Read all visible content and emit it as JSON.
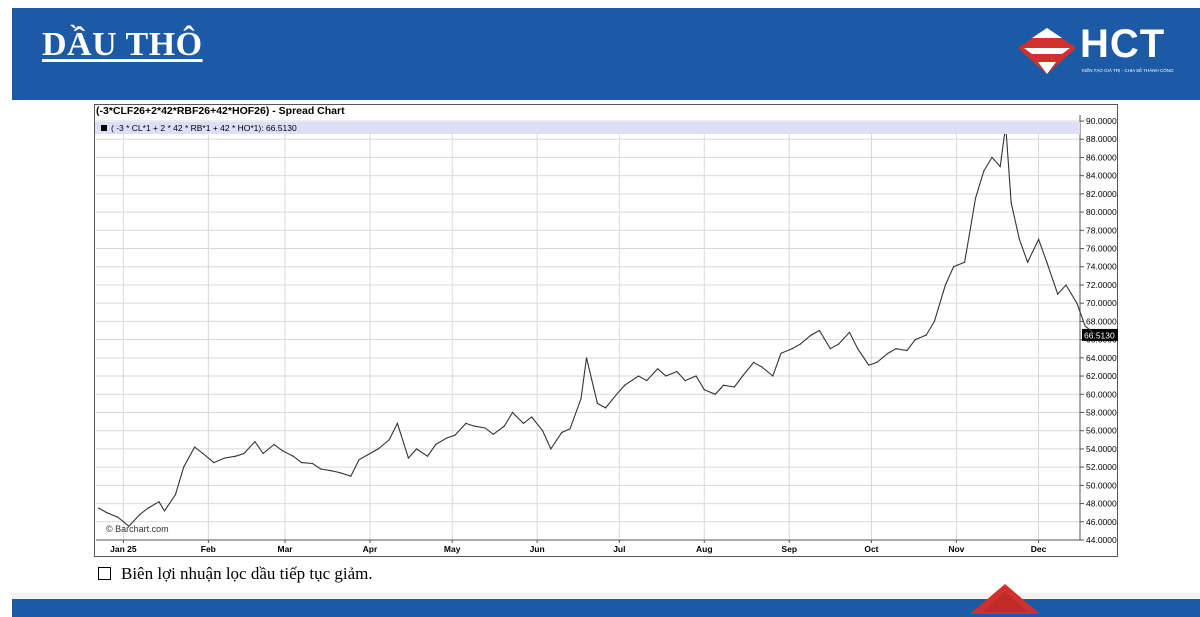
{
  "slide": {
    "title": "DẦU THÔ",
    "logo_text": "HCT",
    "logo_tagline": "KIẾN TẠO GIÁ TRỊ - CHIA SẺ THÀNH CÔNG",
    "note": "Biên lợi nhuận lọc dầu tiếp tục giảm.",
    "colors": {
      "header": "#1c5aa6",
      "logo_red": "#d0312d",
      "line": "#333333"
    }
  },
  "chart_data": {
    "type": "line",
    "title": "(-3*CLF26+2*42*RBF26+42*HOF26) - Spread Chart",
    "legend": "( -3 * CL*1 + 2 * 42 * RB*1 + 42 * HO*1): 66.5130",
    "watermark": "© Barchart.com",
    "last_value_label": "66.5130",
    "last_value": 66.513,
    "ylim": [
      44,
      90
    ],
    "y_ticks": [
      "44.0000",
      "46.0000",
      "48.0000",
      "50.0000",
      "52.0000",
      "54.0000",
      "56.0000",
      "58.0000",
      "60.0000",
      "62.0000",
      "64.0000",
      "66.0000",
      "68.0000",
      "70.0000",
      "72.0000",
      "74.0000",
      "76.0000",
      "78.0000",
      "80.0000",
      "82.0000",
      "84.0000",
      "86.0000",
      "88.0000",
      "90.0000"
    ],
    "x_ticks": [
      "Jan 25",
      "Feb",
      "Mar",
      "Apr",
      "May",
      "Jun",
      "Jul",
      "Aug",
      "Sep",
      "Oct",
      "Nov",
      "Dec"
    ],
    "x_tick_dates": [
      "2025-01-01",
      "2025-02-01",
      "2025-03-01",
      "2025-04-01",
      "2025-05-01",
      "2025-06-01",
      "2025-07-01",
      "2025-08-01",
      "2025-09-01",
      "2025-10-01",
      "2025-11-01",
      "2025-12-01"
    ],
    "grid": true,
    "series": [
      {
        "x": [
          "2024-12-23",
          "2024-12-26",
          "2024-12-30",
          "2025-01-03",
          "2025-01-07",
          "2025-01-10",
          "2025-01-14",
          "2025-01-16",
          "2025-01-20",
          "2025-01-23",
          "2025-01-27",
          "2025-01-30",
          "2025-02-03",
          "2025-02-07",
          "2025-02-11",
          "2025-02-14",
          "2025-02-18",
          "2025-02-21",
          "2025-02-25",
          "2025-02-28",
          "2025-03-04",
          "2025-03-07",
          "2025-03-11",
          "2025-03-14",
          "2025-03-18",
          "2025-03-21",
          "2025-03-25",
          "2025-03-28",
          "2025-04-01",
          "2025-04-04",
          "2025-04-08",
          "2025-04-11",
          "2025-04-15",
          "2025-04-18",
          "2025-04-22",
          "2025-04-25",
          "2025-04-29",
          "2025-05-02",
          "2025-05-06",
          "2025-05-09",
          "2025-05-13",
          "2025-05-16",
          "2025-05-20",
          "2025-05-23",
          "2025-05-27",
          "2025-05-30",
          "2025-06-03",
          "2025-06-06",
          "2025-06-10",
          "2025-06-13",
          "2025-06-17",
          "2025-06-19",
          "2025-06-23",
          "2025-06-26",
          "2025-06-30",
          "2025-07-03",
          "2025-07-08",
          "2025-07-11",
          "2025-07-15",
          "2025-07-18",
          "2025-07-22",
          "2025-07-25",
          "2025-07-29",
          "2025-08-01",
          "2025-08-05",
          "2025-08-08",
          "2025-08-12",
          "2025-08-15",
          "2025-08-19",
          "2025-08-22",
          "2025-08-26",
          "2025-08-29",
          "2025-09-02",
          "2025-09-05",
          "2025-09-09",
          "2025-09-12",
          "2025-09-16",
          "2025-09-19",
          "2025-09-23",
          "2025-09-26",
          "2025-09-30",
          "2025-10-03",
          "2025-10-07",
          "2025-10-10",
          "2025-10-14",
          "2025-10-17",
          "2025-10-21",
          "2025-10-24",
          "2025-10-28",
          "2025-10-31",
          "2025-11-04",
          "2025-11-06",
          "2025-11-08",
          "2025-11-11",
          "2025-11-14",
          "2025-11-17",
          "2025-11-19",
          "2025-11-21",
          "2025-11-24",
          "2025-11-27",
          "2025-12-01",
          "2025-12-04",
          "2025-12-08",
          "2025-12-11",
          "2025-12-15",
          "2025-12-18",
          "2025-12-22"
        ],
        "values": [
          47.5,
          47.0,
          46.5,
          45.5,
          46.8,
          47.5,
          48.2,
          47.2,
          49.0,
          52.0,
          54.2,
          53.5,
          52.5,
          53.0,
          53.2,
          53.5,
          54.8,
          53.5,
          54.5,
          53.8,
          53.2,
          52.5,
          52.4,
          51.8,
          51.6,
          51.4,
          51.0,
          52.8,
          53.5,
          54.0,
          55.0,
          56.8,
          53.0,
          54.0,
          53.2,
          54.5,
          55.2,
          55.5,
          56.8,
          56.5,
          56.3,
          55.6,
          56.5,
          58.0,
          56.8,
          57.5,
          56.0,
          54.0,
          55.8,
          56.2,
          59.5,
          64.0,
          59.0,
          58.5,
          60.0,
          61.0,
          62.0,
          61.5,
          62.8,
          62.0,
          62.5,
          61.5,
          62.0,
          60.5,
          60.0,
          61.0,
          60.8,
          62.0,
          63.5,
          63.0,
          62.0,
          64.5,
          65.0,
          65.5,
          66.5,
          67.0,
          65.0,
          65.5,
          66.8,
          65.0,
          63.2,
          63.5,
          64.5,
          65.0,
          64.8,
          66.0,
          66.5,
          68.0,
          72.0,
          74.0,
          74.5,
          78.0,
          81.5,
          84.5,
          86.0,
          85.0,
          89.5,
          81.0,
          77.0,
          74.5,
          77.0,
          74.5,
          71.0,
          72.0,
          70.0,
          67.5,
          66.5
        ]
      }
    ]
  }
}
